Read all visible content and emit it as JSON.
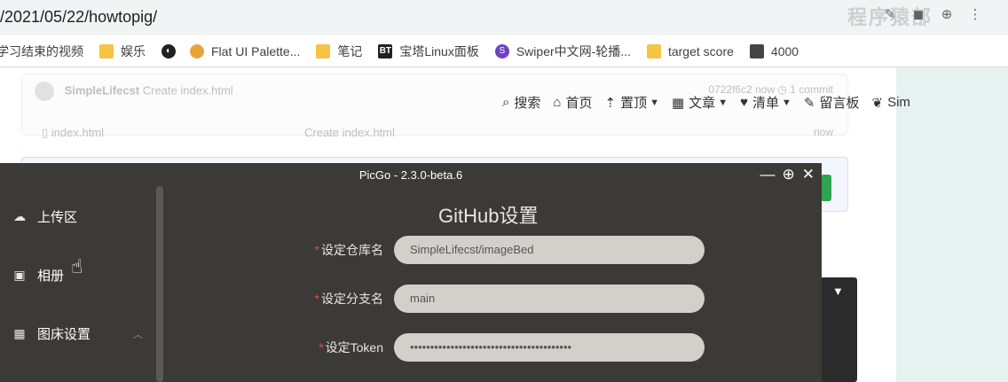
{
  "browser": {
    "url_path": "/2021/05/22/howtopig/",
    "watermark": "程序猿部",
    "icons": [
      "extension-icon",
      "browser-icon",
      "zoom-icon",
      "menu-icon"
    ]
  },
  "bookmarks": [
    {
      "label": "学习结束的视频",
      "icon": "video-icon"
    },
    {
      "label": "娱乐",
      "icon": "folder-icon"
    },
    {
      "label": "",
      "icon": "globe-icon"
    },
    {
      "label": "Flat UI Palette...",
      "icon": "palette-icon"
    },
    {
      "label": "笔记",
      "icon": "folder-icon"
    },
    {
      "label": "宝塔Linux面板",
      "icon": "bt-icon"
    },
    {
      "label": "Swiper中文网-轮播...",
      "icon": "swiper-icon"
    },
    {
      "label": "target score",
      "icon": "folder-icon"
    },
    {
      "label": "4000",
      "icon": "image-icon"
    }
  ],
  "repo": {
    "commit_author": "SimpleLifecst",
    "commit_msg": "Create index.html",
    "commit_hash": "0722f6c2",
    "commit_time": "now",
    "commit_count": "1 commit",
    "file_name": "index.html",
    "file_msg": "Create index.html",
    "file_time": "now"
  },
  "site_nav": [
    {
      "label": "搜索",
      "icon": "search-icon",
      "dropdown": false
    },
    {
      "label": "首页",
      "icon": "home-icon",
      "dropdown": false
    },
    {
      "label": "置顶",
      "icon": "pin-icon",
      "dropdown": true
    },
    {
      "label": "文章",
      "icon": "grid-icon",
      "dropdown": true
    },
    {
      "label": "清单",
      "icon": "heart-icon",
      "dropdown": true
    },
    {
      "label": "留言板",
      "icon": "edit-icon",
      "dropdown": false
    },
    {
      "label": "Sim",
      "icon": "leaf-icon",
      "dropdown": false
    }
  ],
  "picgo": {
    "title": "PicGo - 2.3.0-beta.6",
    "sidebar": [
      {
        "label": "上传区",
        "icon": "cloud-upload-icon"
      },
      {
        "label": "相册",
        "icon": "image-icon"
      },
      {
        "label": "图床设置",
        "icon": "grid-icon"
      }
    ],
    "settings_title": "GitHub设置",
    "fields": [
      {
        "label": "设定仓库名",
        "value": "SimpleLifecst/imageBed"
      },
      {
        "label": "设定分支名",
        "value": "main"
      },
      {
        "label": "设定Token",
        "value": "••••••••••••••••••••••••••••••••••••••••"
      }
    ]
  }
}
